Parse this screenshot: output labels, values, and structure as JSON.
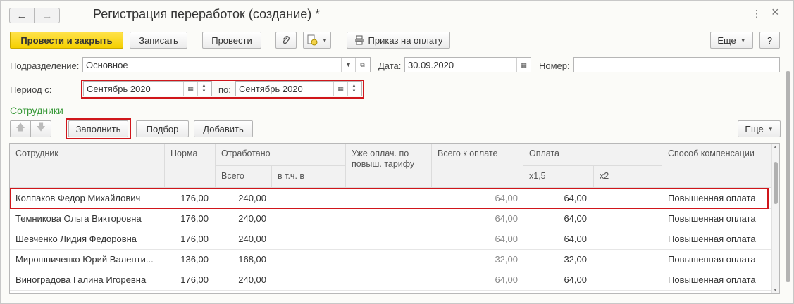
{
  "window": {
    "title": "Регистрация переработок (создание) *",
    "back_icon": "←",
    "forward_icon": "→",
    "menu_icon": "⋮",
    "close_icon": "×"
  },
  "toolbar": {
    "post_close": "Провести и закрыть",
    "save": "Записать",
    "post": "Провести",
    "attach_icon": "📎",
    "print_order": "Приказ на оплату",
    "more": "Еще",
    "help": "?"
  },
  "form": {
    "division_label": "Подразделение:",
    "division_value": "Основное",
    "date_label": "Дата:",
    "date_value": "30.09.2020",
    "number_label": "Номер:",
    "number_value": "",
    "period_label": "Период с:",
    "period_from": "Сентябрь 2020",
    "period_to_label": "по:",
    "period_to": "Сентябрь 2020"
  },
  "employees": {
    "section_title": "Сотрудники",
    "fill": "Заполнить",
    "select": "Подбор",
    "add": "Добавить",
    "more": "Еще",
    "columns": {
      "employee": "Сотрудник",
      "norm": "Норма",
      "worked": "Отработано",
      "worked_total": "Всего",
      "worked_incl": "в т.ч. в",
      "already_paid": "Уже оплач. по повыш. тарифу",
      "total_to_pay": "Всего к оплате",
      "payment": "Оплата",
      "x15": "x1,5",
      "x2": "x2",
      "compensation": "Способ компенсации"
    },
    "rows": [
      {
        "name": "Колпаков Федор Михайлович",
        "norm": "176,00",
        "total": "240,00",
        "incl": "",
        "paid": "",
        "to_pay": "64,00",
        "x15": "64,00",
        "x2": "",
        "method": "Повышенная оплата"
      },
      {
        "name": "Темникова Ольга Викторовна",
        "norm": "176,00",
        "total": "240,00",
        "incl": "",
        "paid": "",
        "to_pay": "64,00",
        "x15": "64,00",
        "x2": "",
        "method": "Повышенная оплата"
      },
      {
        "name": "Шевченко Лидия Федоровна",
        "norm": "176,00",
        "total": "240,00",
        "incl": "",
        "paid": "",
        "to_pay": "64,00",
        "x15": "64,00",
        "x2": "",
        "method": "Повышенная оплата"
      },
      {
        "name": "Мирошниченко Юрий Валенти...",
        "norm": "136,00",
        "total": "168,00",
        "incl": "",
        "paid": "",
        "to_pay": "32,00",
        "x15": "32,00",
        "x2": "",
        "method": "Повышенная оплата"
      },
      {
        "name": "Виноградова Галина Игоревна",
        "norm": "176,00",
        "total": "240,00",
        "incl": "",
        "paid": "",
        "to_pay": "64,00",
        "x15": "64,00",
        "x2": "",
        "method": "Повышенная оплата"
      }
    ]
  }
}
